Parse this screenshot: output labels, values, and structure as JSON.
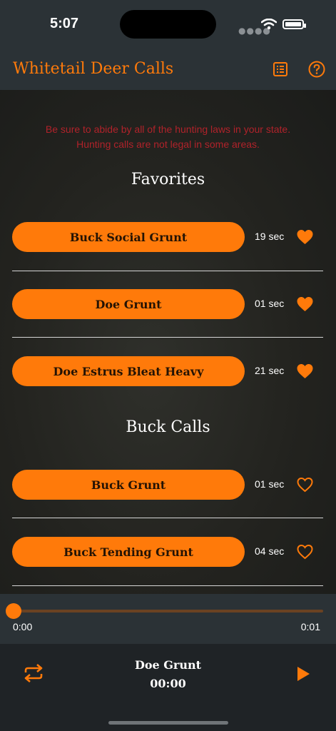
{
  "status_bar": {
    "time": "5:07"
  },
  "app_bar": {
    "title": "Whitetail Deer Calls"
  },
  "warning": {
    "line1": "Be sure to abide by all of the hunting laws in your state.",
    "line2": "Hunting calls are not legal in some areas."
  },
  "sections": {
    "favorites": {
      "title": "Favorites",
      "items": [
        {
          "label": "Buck Social Grunt",
          "duration": "19 sec",
          "favorite": true
        },
        {
          "label": "Doe Grunt",
          "duration": "01 sec",
          "favorite": true
        },
        {
          "label": "Doe Estrus Bleat Heavy",
          "duration": "21 sec",
          "favorite": true
        }
      ]
    },
    "buck_calls": {
      "title": "Buck Calls",
      "items": [
        {
          "label": "Buck Grunt",
          "duration": "01 sec",
          "favorite": false
        },
        {
          "label": "Buck Tending Grunt",
          "duration": "04 sec",
          "favorite": false
        }
      ]
    }
  },
  "player": {
    "elapsed": "0:00",
    "total": "0:01",
    "progress": 0,
    "now_playing": "Doe Grunt",
    "counter": "00:00"
  },
  "colors": {
    "accent": "#ff7a0a",
    "warning": "#b0222a",
    "bar": "#2b3236"
  },
  "icons": {
    "list": "list-icon",
    "help": "help-icon",
    "heart_filled": "heart-filled-icon",
    "heart_outline": "heart-outline-icon",
    "repeat": "repeat-icon",
    "play": "play-icon"
  }
}
